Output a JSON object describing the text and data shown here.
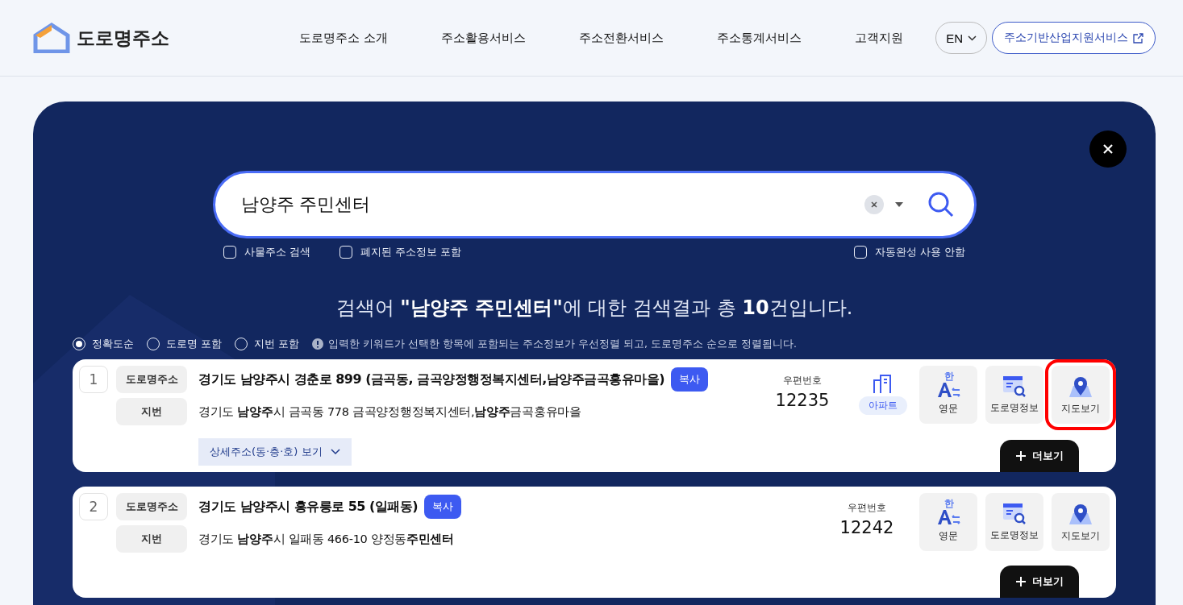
{
  "header": {
    "logo": "도로명주소",
    "nav": [
      "도로명주소 소개",
      "주소활용서비스",
      "주소전환서비스",
      "주소통계서비스",
      "고객지원"
    ],
    "language": "EN",
    "external_link": "주소기반산업지원서비스"
  },
  "search": {
    "value": "남양주 주민센터",
    "options": [
      {
        "label": "사물주소 검색",
        "checked": false
      },
      {
        "label": "폐지된 주소정보 포함",
        "checked": false
      }
    ],
    "autocomplete": {
      "label": "자동완성 사용 안함",
      "checked": false
    }
  },
  "summary": "검색어 **\"남양주 주민센터\"**에 대한 검색결과 총 **10**건입니다.",
  "sort": {
    "options": [
      {
        "label": "정확도순",
        "selected": true
      },
      {
        "label": "도로명 포함",
        "selected": false
      },
      {
        "label": "지번 포함",
        "selected": false
      }
    ],
    "note": "입력한 키워드가 선택한 항목에 포함되는 주소정보가 우선정렬 되고, 도로명주소 순으로 정렬됩니다."
  },
  "results": [
    {
      "number": "1",
      "road_label": "도로명주소",
      "road_address": "경기도 남양주시 경춘로 899 (금곡동, 금곡양정행정복지센터,남양주금곡홍유마을)",
      "copy": "복사",
      "jibun_label": "지번",
      "jibun_address": "경기도 **남양주**시 금곡동 778 금곡양정행정복지센터,**남양주**금곡홍유마을",
      "detail_toggle": "상세주소(동·층·호) 보기",
      "postal_label": "우편번호",
      "postal_code": "12235",
      "building_type": "아파트",
      "actions": [
        {
          "kind": "english",
          "icon_char": "한",
          "label": "영문",
          "highlighted": false
        },
        {
          "kind": "road_info",
          "label": "도로명정보",
          "highlighted": false
        },
        {
          "kind": "map",
          "label": "지도보기",
          "highlighted": true
        }
      ],
      "more": "더보기"
    },
    {
      "number": "2",
      "road_label": "도로명주소",
      "road_address": "경기도 남양주시 홍유릉로 55 (일패동)",
      "copy": "복사",
      "jibun_label": "지번",
      "jibun_address": "경기도 **남양주**시 일패동 466-10 양정동**주민센터**",
      "postal_label": "우편번호",
      "postal_code": "12242",
      "actions": [
        {
          "kind": "english",
          "icon_char": "한",
          "label": "영문",
          "highlighted": false
        },
        {
          "kind": "road_info",
          "label": "도로명정보",
          "highlighted": false
        },
        {
          "kind": "map",
          "label": "지도보기",
          "highlighted": false
        }
      ],
      "more": "더보기"
    }
  ]
}
